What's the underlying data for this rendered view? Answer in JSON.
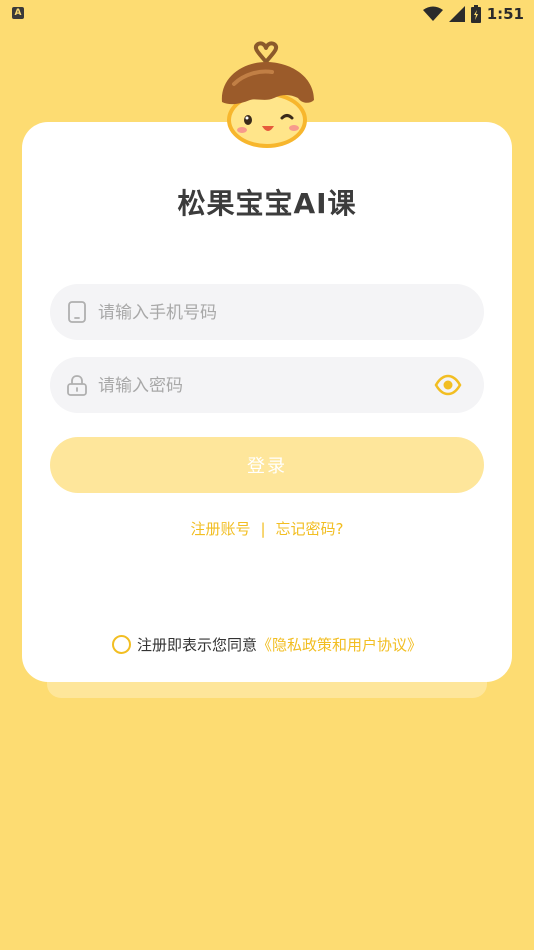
{
  "status_bar": {
    "notification_icon": "A",
    "time": "1:51"
  },
  "app": {
    "title": "松果宝宝AI课"
  },
  "phone_field": {
    "placeholder": "请输入手机号码",
    "value": ""
  },
  "password_field": {
    "placeholder": "请输入密码",
    "value": ""
  },
  "login_button": {
    "label": "登录"
  },
  "links": {
    "register": "注册账号",
    "separator": "|",
    "forgot": "忘记密码?"
  },
  "agreement": {
    "text": "注册即表示您同意",
    "policy": "《隐私政策和用户协议》"
  },
  "colors": {
    "background": "#FDDC72",
    "accent": "#F2BE22",
    "button_disabled": "#FEE69B"
  }
}
